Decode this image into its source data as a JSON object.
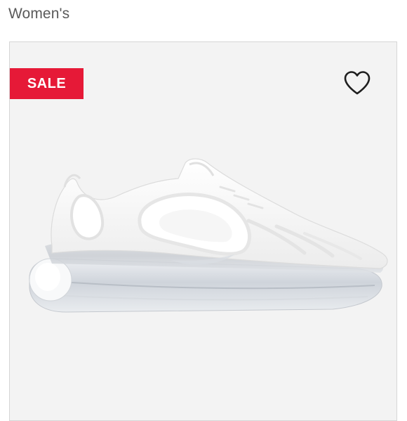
{
  "category": {
    "label": "Women's"
  },
  "product": {
    "badge": {
      "label": "SALE",
      "color": "#e61937"
    },
    "wishlist": {
      "icon": "heart-icon"
    },
    "image": {
      "description_icon": "sneaker-image"
    }
  },
  "colors": {
    "card_background": "#f3f3f3",
    "card_border": "#d6d6d6",
    "text": "#5a5a5a"
  }
}
